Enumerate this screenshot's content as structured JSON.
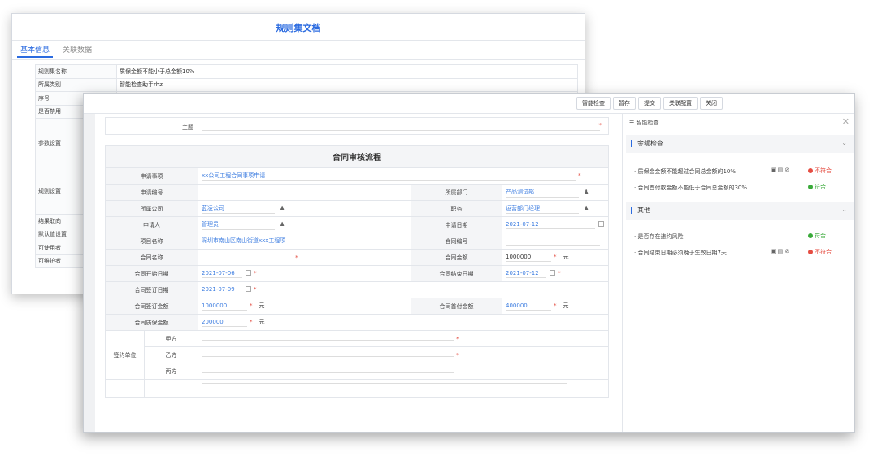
{
  "back": {
    "title": "规则集文档",
    "tabs": [
      "基本信息",
      "关联数据"
    ],
    "rows": [
      {
        "k": "规则集名称",
        "v": "质保金额不能小于总金额10%"
      },
      {
        "k": "所属类别",
        "v": "智能检查助手rhz"
      },
      {
        "k": "序号",
        "v": ""
      },
      {
        "k": "是否禁用",
        "v": ""
      },
      {
        "k": "参数设置",
        "v": ""
      },
      {
        "k": "规则设置",
        "v": ""
      },
      {
        "k": "结果取向",
        "v": ""
      },
      {
        "k": "默认值设置",
        "v": ""
      },
      {
        "k": "可使用者",
        "v": ""
      },
      {
        "k": "可维护者",
        "v": ""
      }
    ]
  },
  "toolbar": {
    "smart_check": "智能检查",
    "save_draft": "暂存",
    "submit": "提交",
    "related_config": "关联配置",
    "close": "关闭"
  },
  "form": {
    "subject_label": "主题",
    "title": "合同审核流程",
    "applicant_item_label": "申请事项",
    "applicant_item_value": "xx公司工程合同事项申请",
    "apply_no_label": "申请编号",
    "dept_label": "所属部门",
    "dept_value": "产品测试部",
    "company_label": "所属公司",
    "company_value": "蓝凌公司",
    "position_label": "职务",
    "position_value": "运营部门经理",
    "applicant_label": "申请人",
    "applicant_value": "管理员",
    "apply_date_label": "申请日期",
    "apply_date_value": "2021-07-12",
    "project_label": "项目名称",
    "project_value": "深圳市南山区南山街道xxx工程项",
    "contract_no_label": "合同编号",
    "contract_name_label": "合同名称",
    "contract_amount_label": "合同金额",
    "contract_amount_value": "1000000",
    "yuan": "元",
    "start_date_label": "合同开始日期",
    "start_date_value": "2021-07-06",
    "end_date_label": "合同结束日期",
    "end_date_value": "2021-07-12",
    "sign_date_label": "合同签订日期",
    "sign_date_value": "2021-07-09",
    "sign_amount_label": "合同签订金额",
    "sign_amount_value": "1000000",
    "advance_label": "合同首付金额",
    "advance_value": "400000",
    "warranty_label": "合同质保金额",
    "warranty_value": "200000",
    "party_label": "签约单位",
    "party_a": "甲方",
    "party_b": "乙方",
    "party_c": "丙方"
  },
  "side": {
    "header": "智能检查",
    "sections": [
      {
        "title": "金额检查",
        "items": [
          {
            "text": "质保金金额不能超过合同总金额的10%",
            "status": "不符合",
            "ok": false
          },
          {
            "text": "合同首付款金额不能低于合同总金额的30%",
            "status": "符合",
            "ok": true
          }
        ]
      },
      {
        "title": "其他",
        "items": [
          {
            "text": "是否存在违约风险",
            "status": "符合",
            "ok": true
          },
          {
            "text": "合同结束日期必须晚于生效日期7天...",
            "status": "不符合",
            "ok": false
          }
        ]
      }
    ]
  }
}
